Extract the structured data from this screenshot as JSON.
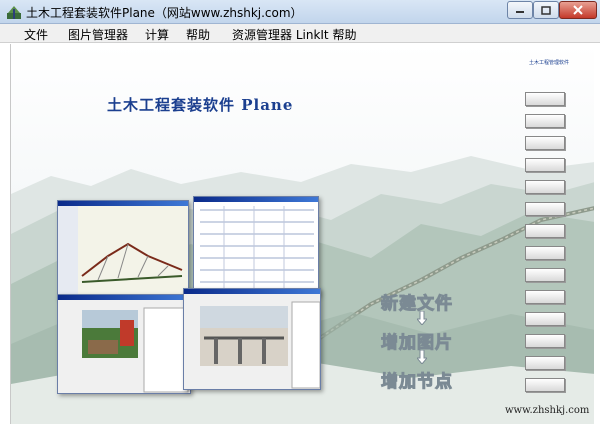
{
  "window": {
    "title": "土木工程套装软件Plane（网站www.zhshkj.com）",
    "minimize_label": "",
    "maximize_label": "",
    "close_label": ""
  },
  "menu": {
    "items": [
      "文件",
      "图片管理器",
      "计算",
      "帮助",
      "资源管理器 LinkIt 帮助"
    ]
  },
  "content": {
    "main_title": "土木工程套装软件 Plane",
    "side_header": "土木工程管理软件",
    "side_buttons": [
      "",
      "",
      "",
      "",
      "",
      "",
      "",
      "",
      "",
      "",
      "",
      "",
      "",
      ""
    ],
    "workflow_steps": [
      "新建文件",
      "增加图片",
      "增加节点"
    ],
    "footer_text": "",
    "website": "www.zhshkj.com"
  },
  "colors": {
    "title_blue": "#1b3f8f",
    "titlebar_top": "#d9e6f5",
    "close_red": "#c4392a"
  }
}
